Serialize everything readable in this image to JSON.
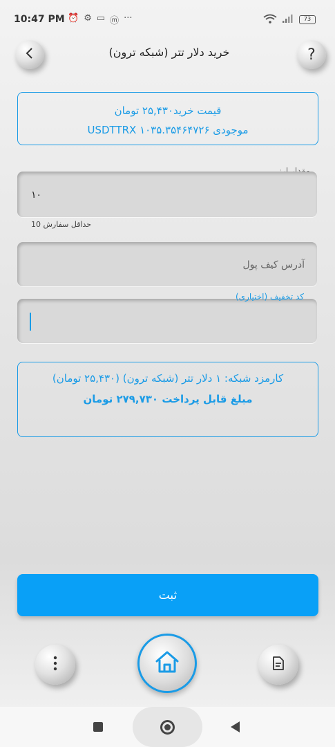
{
  "status": {
    "time": "10:47 PM",
    "more": "···",
    "battery": "73"
  },
  "header": {
    "title": "خرید دلار تتر (شبکه ترون)",
    "back_icon": "chevron-left-icon",
    "help_label": "?"
  },
  "price_box": {
    "line1": "قیمت خرید۲۵,۴۳۰ تومان",
    "line2": "موجودی USDTTRX ۱۰۳۵.۳۵۴۶۴۷۲۶"
  },
  "form": {
    "amount_label": "مقدار ارز",
    "amount_value": "۱۰",
    "min_order": "حداقل سفارش 10",
    "wallet_placeholder": "آدرس کیف پول",
    "discount_label": "کد تخفیف (اختیاری)"
  },
  "fee_box": {
    "fee_text": "کارمزد شبکه: ۱ دلار تتر (شبکه ترون) (۲۵,۴۳۰ تومان)",
    "total_text": "مبلغ قابل پرداخت ۲۷۹,۷۳۰ تومان"
  },
  "submit_label": "ثبت",
  "bottom_nav": {
    "menu_icon": "more-vertical-icon",
    "home_icon": "home-icon",
    "doc_icon": "document-icon"
  },
  "colors": {
    "accent": "#1a9be6",
    "button": "#09a0f7"
  }
}
